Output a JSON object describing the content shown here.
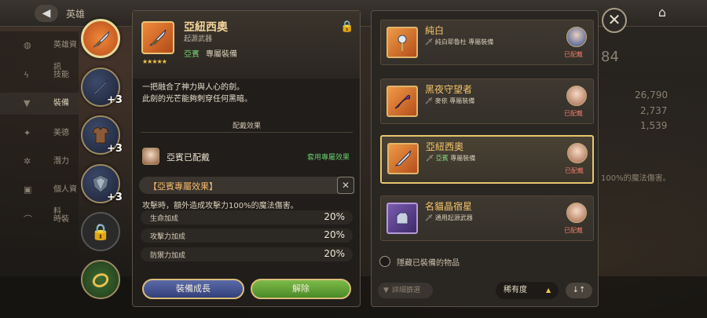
{
  "topbar": {
    "title": "英雄",
    "back_label": "◀"
  },
  "left_nav": {
    "items": [
      {
        "label": "英雄資訊",
        "icon": "info-icon"
      },
      {
        "label": "技能",
        "icon": "skill-icon"
      },
      {
        "label": "裝備",
        "icon": "armor-icon"
      },
      {
        "label": "美德",
        "icon": "virtue-icon"
      },
      {
        "label": "潛力",
        "icon": "potential-icon"
      },
      {
        "label": "個人資料",
        "icon": "profile-icon"
      },
      {
        "label": "時裝",
        "icon": "costume-icon"
      }
    ]
  },
  "equipment_slots": {
    "weapon_selected": true,
    "slot_plus": [
      "+3",
      "+3",
      "+3"
    ]
  },
  "detail": {
    "name": "亞紐西奧",
    "type": "起源武器",
    "stars": "★★★★★",
    "exclusive_hero": "亞賓",
    "exclusive_label": "專屬裝備",
    "description_line1": "一把融合了神力與人心的劍。",
    "description_line2": "此劍的光芒能夠刺穿任何黑暗。",
    "equip_section_title": "配戴效果",
    "equipped_by": "亞賓已配戴",
    "applied_label": "套用專屬效果",
    "exclusive_effect_title": "【亞賓專屬效果】",
    "exclusive_effect_desc": "攻擊時，額外造成攻擊力100%的魔法傷害。",
    "stats": [
      {
        "label": "生命加成",
        "value": "20%"
      },
      {
        "label": "攻擊力加成",
        "value": "20%"
      },
      {
        "label": "防禦力加成",
        "value": "20%"
      }
    ],
    "upgrade_button": "裝備成長",
    "release_button": "解除"
  },
  "equipment_list": {
    "items": [
      {
        "name": "純白",
        "sub": "純白耶魯杜 專屬裝備",
        "equipped": "已配戴",
        "selected": false
      },
      {
        "name": "黑夜守望者",
        "sub": "麥依 專屬裝備",
        "equipped": "已配戴",
        "selected": false
      },
      {
        "name": "亞紐西奧",
        "sub_green": "亞賓",
        "sub": "專屬裝備",
        "equipped": "已配戴",
        "selected": true
      },
      {
        "name": "名貓晶宿星",
        "sub": "通用起源武器",
        "equipped": "已配戴",
        "selected": false
      }
    ],
    "hide_equipped_label": "隱藏已裝備的物品",
    "filter_label": "詳細篩選",
    "sort_label": "稀有度",
    "order_label": "↓↑"
  },
  "background_numbers": [
    "84",
    "26,790",
    "2,737",
    "1,539",
    "100%的魔法傷害。"
  ],
  "close_label": "✕"
}
